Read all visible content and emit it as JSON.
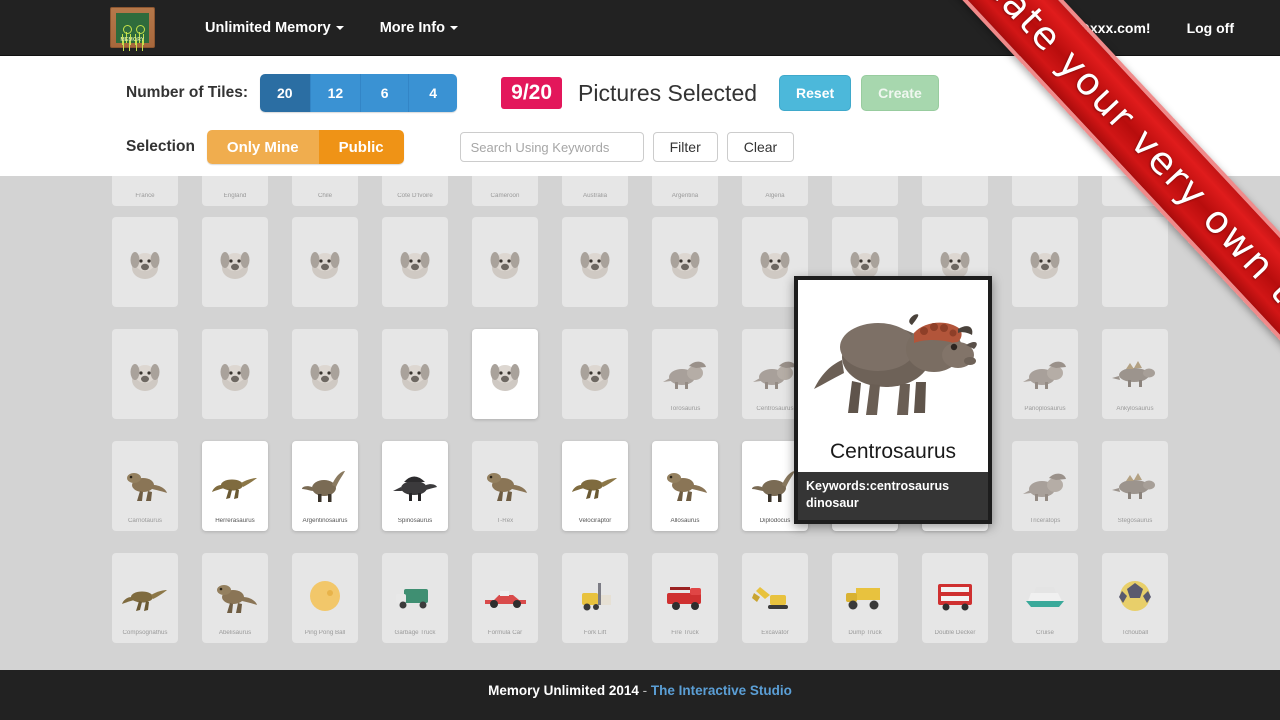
{
  "navbar": {
    "logo_word": "MEMORY",
    "links": [
      {
        "label": "Unlimited Memory",
        "caret": true
      },
      {
        "label": "More Info",
        "caret": true
      }
    ],
    "greeting": "Hello xxx@xxx.com!",
    "logoff": "Log off"
  },
  "controls": {
    "tiles_label": "Number of Tiles:",
    "tile_options": [
      "20",
      "12",
      "6",
      "4"
    ],
    "tile_selected": "20",
    "count_badge": "9/20",
    "count_text": "Pictures Selected",
    "reset_label": "Reset",
    "create_label": "Create",
    "selection_label": "Selection",
    "selection_options": [
      "Only Mine",
      "Public"
    ],
    "selection_active": "Public",
    "search_placeholder": "Search Using Keywords",
    "search_value": "",
    "filter_label": "Filter",
    "clear_label": "Clear"
  },
  "popup": {
    "title": "Centrosaurus",
    "keywords_line1": "Keywords:centrosaurus",
    "keywords_line2": "dinosaur"
  },
  "ribbon": {
    "text": "Create your very own tiles"
  },
  "footer": {
    "title": "Memory Unlimited 2014",
    "dash": " - ",
    "studio": "The Interactive Studio"
  },
  "colors": {
    "navbar_bg": "#222222",
    "grid_bg": "#d3d3d3",
    "badge_pink": "#e3175b",
    "tile_blue": "#3a92d3",
    "tile_blue_active": "#2b6ea3",
    "selection_orange": "#f0ad4e",
    "selection_orange_active": "#ef9316",
    "reset_cyan": "#4cb8da",
    "create_green": "#a7d7ae",
    "ribbon_red": "#c21414"
  },
  "grid": {
    "rows": [
      {
        "clipped": true,
        "cells": [
          {
            "caption": "France",
            "icon": "flag-france",
            "selected": false
          },
          {
            "caption": "England",
            "icon": "flag-england",
            "selected": false
          },
          {
            "caption": "Chile",
            "icon": "flag-chile",
            "selected": false
          },
          {
            "caption": "Cote D'Ivoire",
            "icon": "flag-ivorycoast",
            "selected": false
          },
          {
            "caption": "Cameroon",
            "icon": "flag-cameroon",
            "selected": false
          },
          {
            "caption": "Australia",
            "icon": "flag-australia",
            "selected": false
          },
          {
            "caption": "Argentina",
            "icon": "flag-argentina",
            "selected": false
          },
          {
            "caption": "Algeria",
            "icon": "flag-algeria",
            "selected": false
          },
          {
            "caption": "",
            "icon": "blank",
            "selected": false
          },
          {
            "caption": "",
            "icon": "blank",
            "selected": false
          },
          {
            "caption": "",
            "icon": "blank",
            "selected": false
          },
          {
            "caption": "",
            "icon": "blank",
            "selected": false
          }
        ]
      },
      {
        "clipped": false,
        "cells": [
          {
            "caption": "",
            "icon": "dog-beagle-pup",
            "selected": false
          },
          {
            "caption": "",
            "icon": "dog-border-collie",
            "selected": false
          },
          {
            "caption": "",
            "icon": "dog-poodle-grey",
            "selected": false
          },
          {
            "caption": "",
            "icon": "dog-hound-tan",
            "selected": false
          },
          {
            "caption": "",
            "icon": "dog-lab-choc",
            "selected": false
          },
          {
            "caption": "",
            "icon": "dog-pug-dark",
            "selected": false
          },
          {
            "caption": "",
            "icon": "dog-lab-yellow",
            "selected": false
          },
          {
            "caption": "",
            "icon": "dog-terrier-white",
            "selected": false
          },
          {
            "caption": "",
            "icon": "dog-puppy-cream",
            "selected": false
          },
          {
            "caption": "",
            "icon": "dog-bulldog-white",
            "selected": false
          },
          {
            "caption": "",
            "icon": "dog-dalmatian",
            "selected": false
          },
          {
            "caption": "",
            "icon": "blank",
            "selected": false
          }
        ]
      },
      {
        "clipped": false,
        "cells": [
          {
            "caption": "",
            "icon": "dog-husky-pup",
            "selected": false
          },
          {
            "caption": "",
            "icon": "dog-pink-tongue",
            "selected": false
          },
          {
            "caption": "",
            "icon": "dog-grey-spaniel",
            "selected": false
          },
          {
            "caption": "",
            "icon": "dog-dachshund",
            "selected": false
          },
          {
            "caption": "",
            "icon": "dog-bulldog-tongue",
            "selected": true
          },
          {
            "caption": "",
            "icon": "dog-floppy-ears",
            "selected": false
          },
          {
            "caption": "Torosaurus",
            "icon": "dino-torosaurus",
            "selected": false
          },
          {
            "caption": "Centrosaurus",
            "icon": "dino-centrosaurus",
            "selected": false
          },
          {
            "caption": "",
            "icon": "blank",
            "selected": false
          },
          {
            "caption": "",
            "icon": "blank",
            "selected": false
          },
          {
            "caption": "Panoplosaurus",
            "icon": "dino-panoplosaurus",
            "selected": false
          },
          {
            "caption": "Ankylosaurus",
            "icon": "dino-ankylosaurus",
            "selected": false
          }
        ]
      },
      {
        "clipped": false,
        "cells": [
          {
            "caption": "Carnotaurus",
            "icon": "dino-carnotaurus",
            "selected": false
          },
          {
            "caption": "Herrerasaurus",
            "icon": "dino-herrerasaurus",
            "selected": true
          },
          {
            "caption": "Argentinosaurus",
            "icon": "dino-argentinosaurus",
            "selected": true
          },
          {
            "caption": "Spinosaurus",
            "icon": "dino-spinosaurus",
            "selected": true
          },
          {
            "caption": "T-Rex",
            "icon": "dino-trex",
            "selected": false
          },
          {
            "caption": "Velociraptor",
            "icon": "dino-velociraptor",
            "selected": true
          },
          {
            "caption": "Allosaurus",
            "icon": "dino-allosaurus",
            "selected": true
          },
          {
            "caption": "Diplodocus",
            "icon": "dino-diplodocus",
            "selected": true
          },
          {
            "caption": "",
            "icon": "blank",
            "selected": true
          },
          {
            "caption": "",
            "icon": "blank",
            "selected": true
          },
          {
            "caption": "Triceratops",
            "icon": "dino-triceratops",
            "selected": false
          },
          {
            "caption": "Stegosaurus",
            "icon": "dino-stegosaurus",
            "selected": false
          }
        ]
      },
      {
        "clipped": false,
        "cells": [
          {
            "caption": "Compsognathus",
            "icon": "dino-compsognathus",
            "selected": false
          },
          {
            "caption": "Abelisaurus",
            "icon": "dino-abelisaurus",
            "selected": false
          },
          {
            "caption": "Ping Pong Ball",
            "icon": "ball-pingpong",
            "selected": false
          },
          {
            "caption": "Garbage Truck",
            "icon": "truck-garbage",
            "selected": false
          },
          {
            "caption": "Formula Car",
            "icon": "car-formula",
            "selected": false
          },
          {
            "caption": "Fork Lift",
            "icon": "truck-forklift",
            "selected": false
          },
          {
            "caption": "Fire Truck",
            "icon": "truck-fire",
            "selected": false
          },
          {
            "caption": "Excavator",
            "icon": "truck-excavator",
            "selected": false
          },
          {
            "caption": "Dump Truck",
            "icon": "truck-dump",
            "selected": false
          },
          {
            "caption": "Double Decker",
            "icon": "bus-doubledecker",
            "selected": false
          },
          {
            "caption": "Cruise",
            "icon": "ship-cruise",
            "selected": false
          },
          {
            "caption": "Tchouball",
            "icon": "ball-tchoukball",
            "selected": false
          }
        ]
      }
    ]
  }
}
